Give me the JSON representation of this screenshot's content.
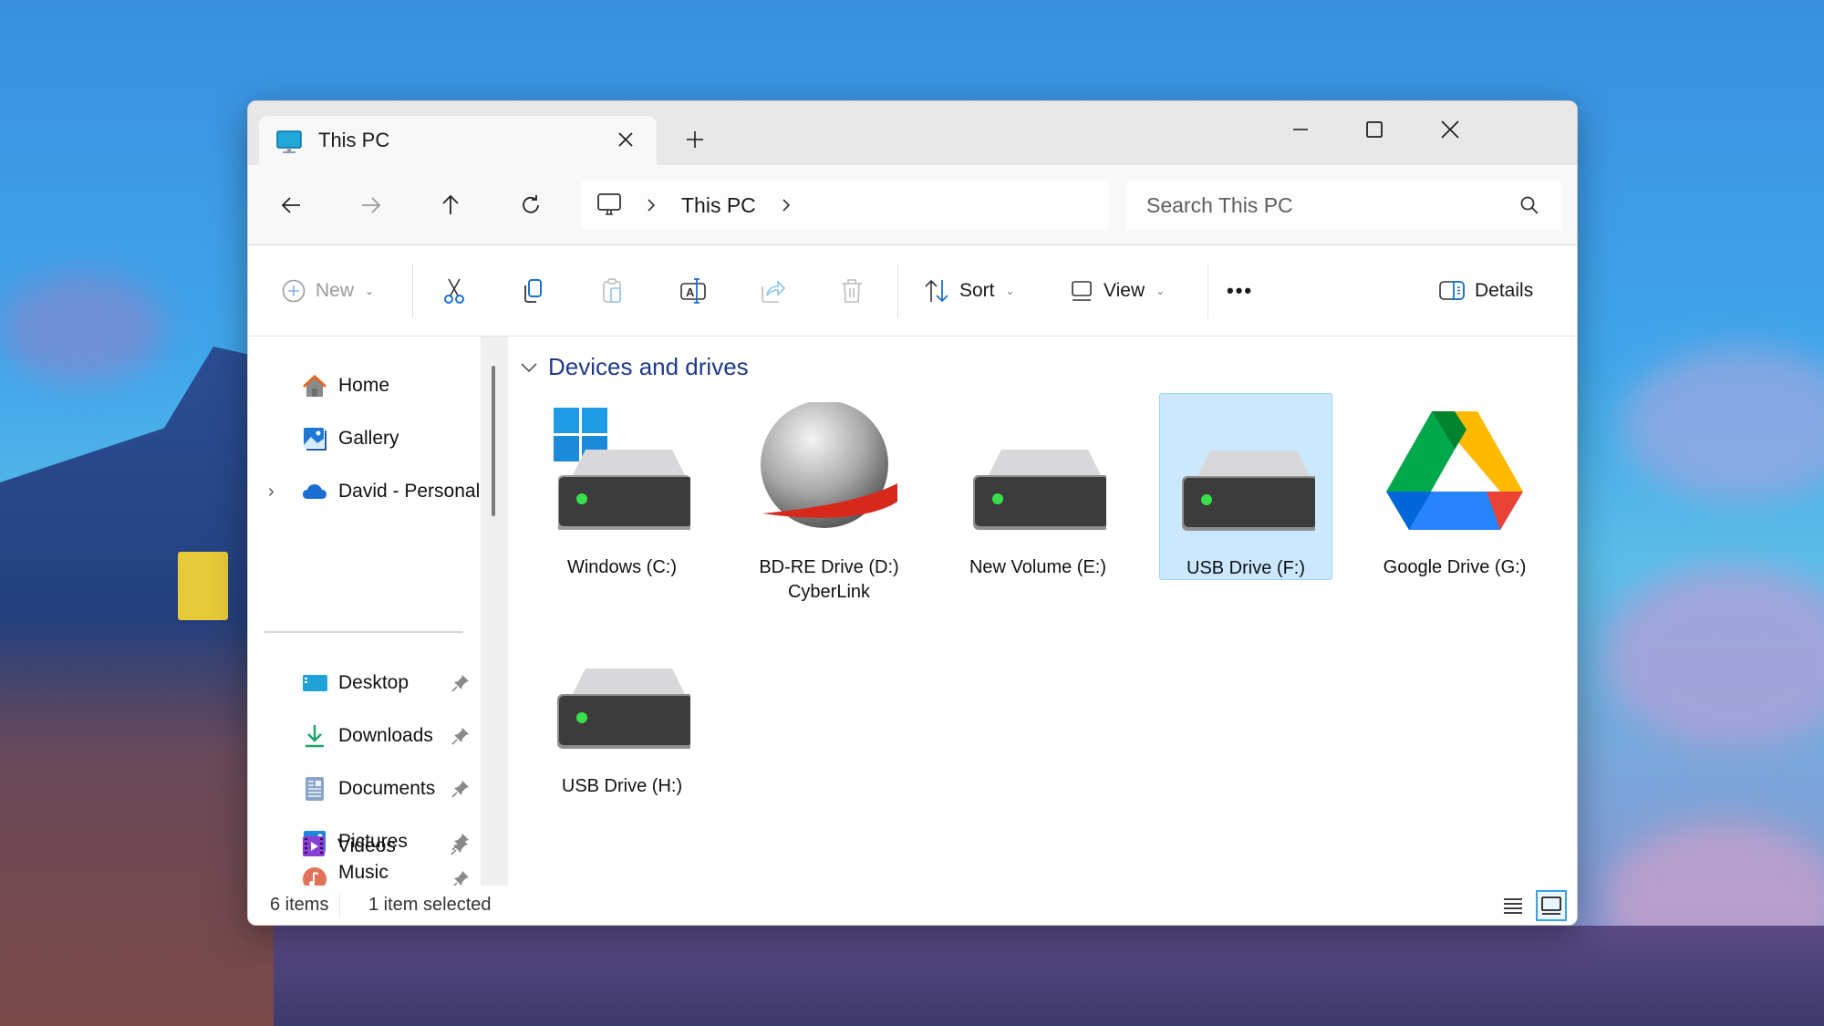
{
  "window": {
    "tab_title": "This PC",
    "tab_icon": "monitor-icon",
    "new_tab_label": "+",
    "controls": [
      "minimize",
      "maximize",
      "close"
    ]
  },
  "address": {
    "breadcrumb": [
      "This PC"
    ],
    "search_placeholder": "Search This PC"
  },
  "commands": {
    "new": "New",
    "cut": "Cut",
    "copy": "Copy",
    "paste": "Paste",
    "rename": "Rename",
    "share": "Share",
    "delete": "Delete",
    "sort": "Sort",
    "view": "View",
    "more": "•••",
    "details": "Details"
  },
  "sidebar": {
    "top_items": [
      {
        "label": "Home",
        "icon": "home-icon"
      },
      {
        "label": "Gallery",
        "icon": "gallery-icon"
      },
      {
        "label": "David - Personal",
        "icon": "onedrive-cloud-icon",
        "expandable": true
      }
    ],
    "pinned_items": [
      {
        "label": "Desktop",
        "icon": "desktop-folder-icon"
      },
      {
        "label": "Downloads",
        "icon": "downloads-icon"
      },
      {
        "label": "Documents",
        "icon": "documents-icon"
      },
      {
        "label": "Pictures",
        "icon": "pictures-icon"
      },
      {
        "label": "Music",
        "icon": "music-icon"
      },
      {
        "label": "Videos",
        "icon": "videos-icon"
      }
    ]
  },
  "content": {
    "group_title": "Devices and drives",
    "drives": [
      {
        "label": "Windows (C:)",
        "icon": "windows-drive-icon",
        "selected": false
      },
      {
        "label": "BD-RE Drive (D:)",
        "label2": "CyberLink",
        "icon": "cyberlink-bd-drive-icon",
        "selected": false
      },
      {
        "label": "New Volume (E:)",
        "icon": "hard-drive-icon",
        "selected": false
      },
      {
        "label": "USB Drive (F:)",
        "icon": "hard-drive-icon",
        "selected": true
      },
      {
        "label": "Google Drive (G:)",
        "icon": "google-drive-icon",
        "selected": false
      },
      {
        "label": "USB Drive (H:)",
        "icon": "hard-drive-icon",
        "selected": false
      }
    ]
  },
  "status": {
    "item_count": "6 items",
    "selection": "1 item selected",
    "active_view": "tiles"
  },
  "colors": {
    "accent": "#0067c0",
    "selection_bg": "#cce8ff",
    "selection_border": "#99d1ff",
    "group_header": "#1e3a8a"
  }
}
